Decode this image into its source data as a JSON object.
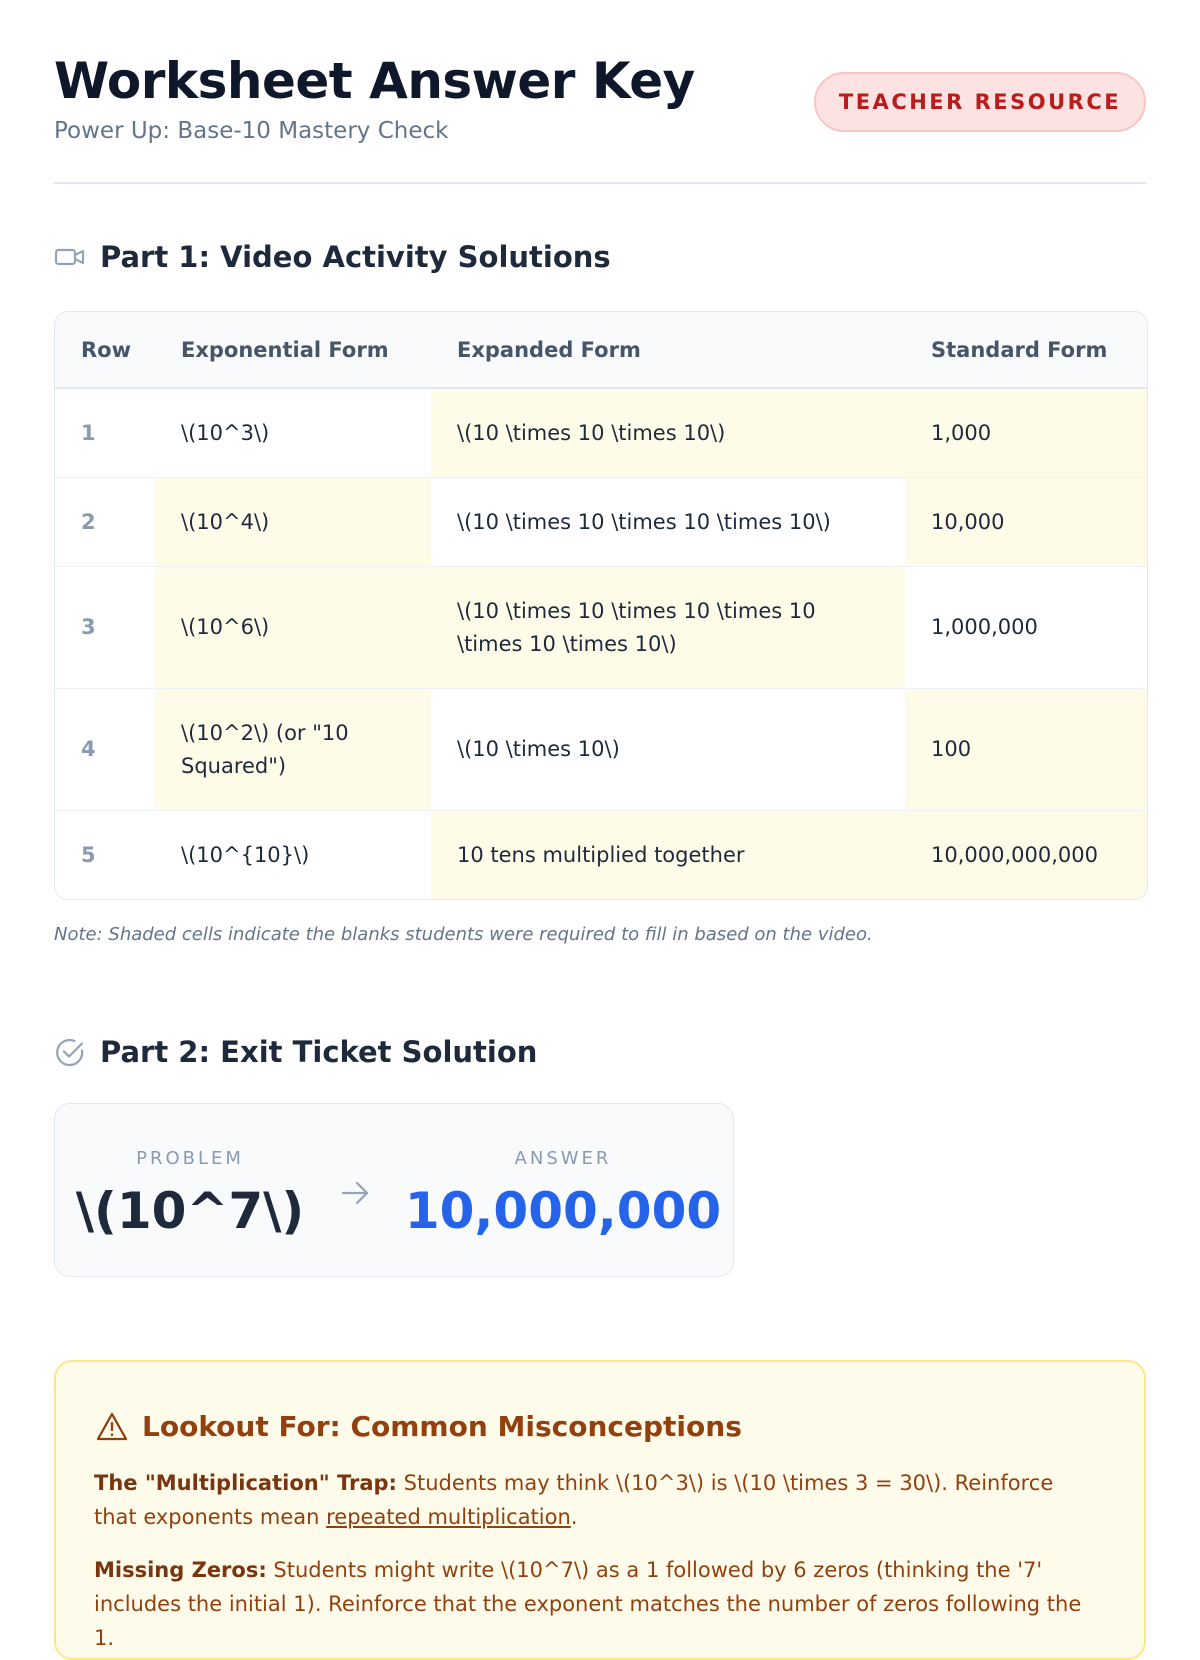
{
  "header": {
    "title": "Worksheet Answer Key",
    "subtitle": "Power Up: Base-10 Mastery Check",
    "badge": "TEACHER RESOURCE"
  },
  "part1": {
    "heading": "Part 1: Video Activity Solutions",
    "icon": "video-camera-icon",
    "columns": [
      "Row",
      "Exponential Form",
      "Expanded Form",
      "Standard Form"
    ],
    "rows": [
      {
        "row": "1",
        "exponential": "\\(10^3\\)",
        "expanded": "\\(10 \\times 10 \\times 10\\)",
        "standard": "1,000",
        "shaded": [
          false,
          false,
          true,
          true
        ]
      },
      {
        "row": "2",
        "exponential": "\\(10^4\\)",
        "expanded": "\\(10 \\times 10 \\times 10 \\times 10\\)",
        "standard": "10,000",
        "shaded": [
          false,
          true,
          false,
          true
        ]
      },
      {
        "row": "3",
        "exponential": "\\(10^6\\)",
        "expanded": "\\(10 \\times 10 \\times 10 \\times 10 \\times 10 \\times 10\\)",
        "standard": "1,000,000",
        "shaded": [
          false,
          true,
          true,
          false
        ]
      },
      {
        "row": "4",
        "exponential": "\\(10^2\\) (or \"10 Squared\")",
        "expanded": "\\(10 \\times 10\\)",
        "standard": "100",
        "shaded": [
          false,
          true,
          false,
          true
        ]
      },
      {
        "row": "5",
        "exponential": "\\(10^{10}\\)",
        "expanded": "10 tens multiplied together",
        "standard": "10,000,000,000",
        "shaded": [
          false,
          false,
          true,
          true
        ]
      }
    ],
    "note": "Note: Shaded cells indicate the blanks students were required to fill in based on the video."
  },
  "part2": {
    "heading": "Part 2: Exit Ticket Solution",
    "icon": "check-circle-icon",
    "problem_label": "PROBLEM",
    "problem": "\\(10^7\\)",
    "answer_label": "ANSWER",
    "answer": "10,000,000"
  },
  "misconceptions": {
    "heading": "Lookout For: Common Misconceptions",
    "icon": "warning-triangle-icon",
    "items": [
      {
        "title": "The \"Multiplication\" Trap:",
        "text_before": " Students may think \\(10^3\\) is \\(10 \\times 3 = 30\\). Reinforce that exponents mean ",
        "emphasis": "repeated multiplication",
        "text_after": "."
      },
      {
        "title": "Missing Zeros:",
        "text_before": " Students might write \\(10^7\\) as a 1 followed by 6 zeros (thinking the '7' includes the initial 1). Reinforce that the exponent matches the number of zeros following the 1.",
        "emphasis": "",
        "text_after": ""
      }
    ]
  },
  "colors": {
    "badge_text": "#b91c1c",
    "badge_bg": "#fde2e2",
    "shaded_cell": "#fefce8",
    "answer": "#2563eb",
    "callout_text": "#92400e",
    "callout_bg": "#fffbeb"
  }
}
